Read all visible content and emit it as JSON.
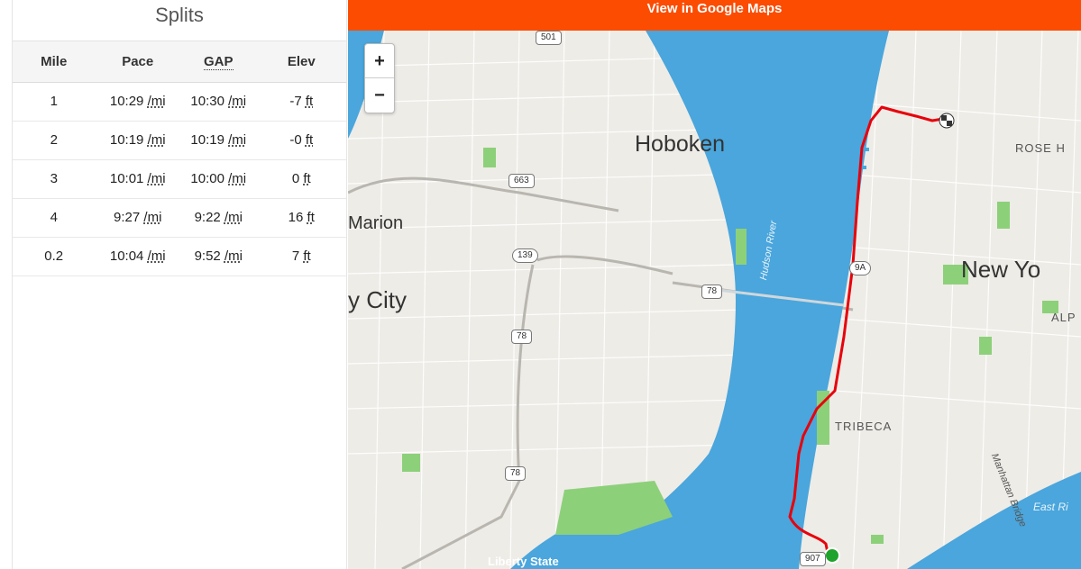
{
  "splits": {
    "title": "Splits",
    "headers": {
      "mile": "Mile",
      "pace": "Pace",
      "gap": "GAP",
      "elev": "Elev"
    },
    "rows": [
      {
        "mile": "1",
        "pace": "10:29",
        "pace_unit": "/mi",
        "gap": "10:30",
        "gap_unit": "/mi",
        "elev": "-7",
        "elev_unit": "ft"
      },
      {
        "mile": "2",
        "pace": "10:19",
        "pace_unit": "/mi",
        "gap": "10:19",
        "gap_unit": "/mi",
        "elev": "-0",
        "elev_unit": "ft"
      },
      {
        "mile": "3",
        "pace": "10:01",
        "pace_unit": "/mi",
        "gap": "10:00",
        "gap_unit": "/mi",
        "elev": "0",
        "elev_unit": "ft"
      },
      {
        "mile": "4",
        "pace": "9:27",
        "pace_unit": "/mi",
        "gap": "9:22",
        "gap_unit": "/mi",
        "elev": "16",
        "elev_unit": "ft"
      },
      {
        "mile": "0.2",
        "pace": "10:04",
        "pace_unit": "/mi",
        "gap": "9:52",
        "gap_unit": "/mi",
        "elev": "7",
        "elev_unit": "ft"
      }
    ]
  },
  "map": {
    "banner_label": "View in Google Maps",
    "zoom_in": "+",
    "zoom_out": "−",
    "labels": {
      "hoboken": "Hoboken",
      "new_york": "New Yo",
      "marion": "Marion",
      "city": "y City",
      "hudson_river": "Hudson River",
      "tribeca": "TRIBECA",
      "rose_hill": "ROSE H",
      "alp": "ALP",
      "manhattan_bridge": "Manhattan Bridge",
      "east_river": "East Ri",
      "liberty_state": "Liberty State"
    },
    "shields": {
      "r501": "501",
      "r663": "663",
      "r139": "139",
      "r78a": "78",
      "r78b": "78",
      "r78c": "78",
      "r9a": "9A",
      "r907": "907"
    },
    "colors": {
      "water": "#4aa6dc",
      "land": "#eeece7",
      "park": "#8dd07a",
      "route": "#e8000b",
      "start_marker": "#1fa32c",
      "banner": "#fc4c02"
    }
  }
}
